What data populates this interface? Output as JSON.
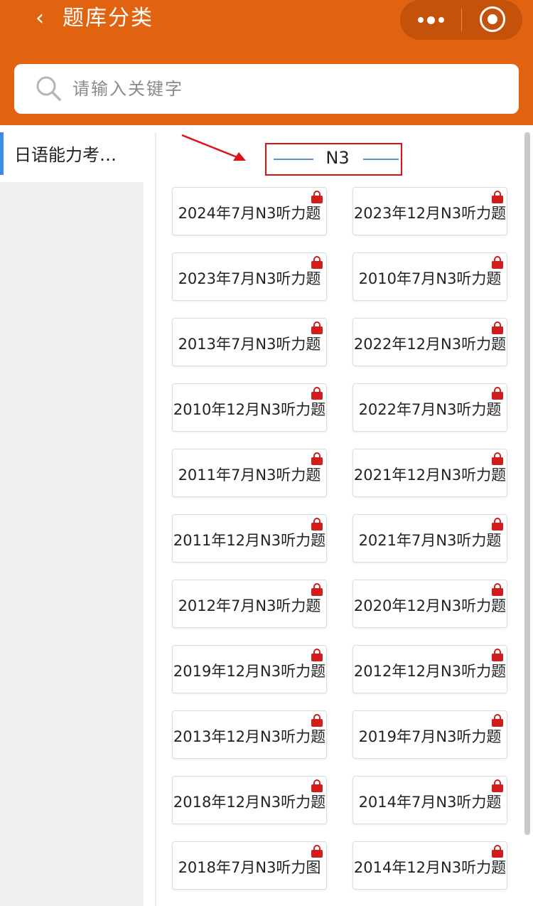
{
  "header": {
    "back_icon": "chevron-left-icon",
    "title": "题库分类",
    "more_icon": "more-dots-icon",
    "close_icon": "target-close-icon",
    "color": "#e1630f"
  },
  "search": {
    "placeholder": "请输入关键字",
    "value": "",
    "icon": "search-icon"
  },
  "sidebar": {
    "items": [
      {
        "label": "日语能力考…",
        "active": true,
        "accent": "#3d8de0"
      }
    ]
  },
  "section": {
    "title": "N3",
    "highlight_color": "#e0101a"
  },
  "items": [
    {
      "label": "2024年7月N3听力题",
      "locked": true
    },
    {
      "label": "2023年12月N3听力题",
      "locked": true
    },
    {
      "label": "2023年7月N3听力题",
      "locked": true
    },
    {
      "label": "2010年7月N3听力题",
      "locked": true
    },
    {
      "label": "2013年7月N3听力题",
      "locked": true
    },
    {
      "label": "2022年12月N3听力题",
      "locked": true
    },
    {
      "label": "2010年12月N3听力题",
      "locked": true
    },
    {
      "label": "2022年7月N3听力题",
      "locked": true
    },
    {
      "label": "2011年7月N3听力题",
      "locked": true
    },
    {
      "label": "2021年12月N3听力题",
      "locked": true
    },
    {
      "label": "2011年12月N3听力题",
      "locked": true
    },
    {
      "label": "2021年7月N3听力题",
      "locked": true
    },
    {
      "label": "2012年7月N3听力题",
      "locked": true
    },
    {
      "label": "2020年12月N3听力题",
      "locked": true
    },
    {
      "label": "2019年12月N3听力题",
      "locked": true
    },
    {
      "label": "2012年12月N3听力题",
      "locked": true
    },
    {
      "label": "2013年12月N3听力题",
      "locked": true
    },
    {
      "label": "2019年7月N3听力题",
      "locked": true
    },
    {
      "label": "2018年12月N3听力题",
      "locked": true
    },
    {
      "label": "2014年7月N3听力题",
      "locked": true
    },
    {
      "label": "2018年7月N3听力图",
      "locked": true
    },
    {
      "label": "2014年12月N3听力题",
      "locked": true
    }
  ]
}
